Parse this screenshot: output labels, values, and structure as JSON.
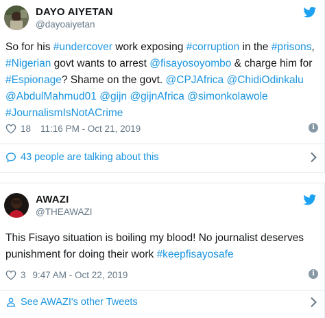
{
  "tweets": [
    {
      "name": "DAYO AIYETAN",
      "handle": "@dayoaiyetan",
      "segments": [
        {
          "t": "So for his ",
          "link": false
        },
        {
          "t": "#undercover",
          "link": true
        },
        {
          "t": " work exposing ",
          "link": false
        },
        {
          "t": "#corruption",
          "link": true
        },
        {
          "t": " in the ",
          "link": false
        },
        {
          "t": "#prisons",
          "link": true
        },
        {
          "t": ", ",
          "link": false
        },
        {
          "t": "#Nigerian",
          "link": true
        },
        {
          "t": " govt wants to arrest ",
          "link": false
        },
        {
          "t": "@fisayosoyombo",
          "link": true
        },
        {
          "t": " & charge him for ",
          "link": false
        },
        {
          "t": "#Espionage",
          "link": true
        },
        {
          "t": "? Shame on the govt. ",
          "link": false
        },
        {
          "t": "@CPJAfrica",
          "link": true
        },
        {
          "t": " ",
          "link": false
        },
        {
          "t": "@ChidiOdinkalu",
          "link": true
        },
        {
          "t": " ",
          "link": false
        },
        {
          "t": "@AbdulMahmud01",
          "link": true
        },
        {
          "t": " ",
          "link": false
        },
        {
          "t": "@gijn",
          "link": true
        },
        {
          "t": " ",
          "link": false
        },
        {
          "t": "@gijnAfrica",
          "link": true
        },
        {
          "t": " ",
          "link": false
        },
        {
          "t": "@simonkolawole",
          "link": true
        },
        {
          "t": " ",
          "link": false
        },
        {
          "t": "#JournalismIsNotACrime",
          "link": true
        }
      ],
      "likes": "18",
      "timestamp": "11:16 PM - Oct 21, 2019",
      "footer": "43 people are talking about this",
      "footer_icon": "speech-bubble-icon"
    },
    {
      "name": "AWAZI",
      "handle": "@THEAWAZI",
      "segments": [
        {
          "t": "This Fisayo situation is boiling my blood! No journalist deserves punishment for doing their work ",
          "link": false
        },
        {
          "t": "#keepfisayosafe",
          "link": true
        }
      ],
      "likes": "3",
      "timestamp": "9:47 AM - Oct 22, 2019",
      "footer": "See AWAZI's other Tweets",
      "footer_icon": "person-icon"
    }
  ],
  "colors": {
    "link": "#1b95e0",
    "meta": "#657786",
    "text": "#14171a",
    "twitter_blue": "#1da1f2",
    "border": "#e1e8ed"
  },
  "icons": {
    "info": "i"
  }
}
